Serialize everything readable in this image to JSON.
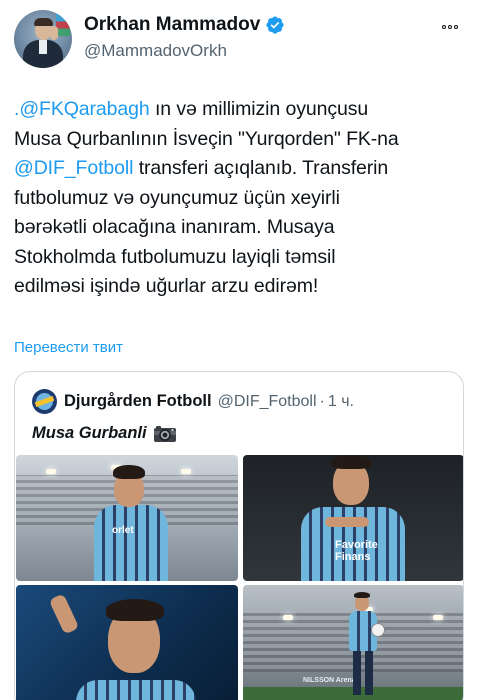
{
  "author": {
    "display_name": "Orkhan Mammadov",
    "handle": "@MammadovOrkh"
  },
  "tweet": {
    "line1_mention": ".@FKQarabagh",
    "line1_rest": " ın və millimizin oyunçusu",
    "line2": "Musa Qurbanlının İsveçin \"Yurqorden\"  FK-na",
    "line3_mention": "@DIF_Fotboll",
    "line3_rest": " transferi açıqlanıb. Transferin",
    "line4": "futbolumuz və oyunçumuz üçün xeyirli",
    "line5": "bərəkətli olacağına inanıram. Musaya",
    "line6": "Stokholmda futbolumuzu layiqli təmsil",
    "line7": "edilməsi işində uğurlar arzu edirəm!"
  },
  "translate_label": "Перевести твит",
  "quote": {
    "display_name": "Djurgården Fotboll",
    "handle": "@DIF_Fotboll",
    "separator": "·",
    "time": "1 ч.",
    "text": "Musa Gurbanli"
  },
  "photos": {
    "p1_sponsor": "orlet",
    "p2_sponsor": "Favorite Finans",
    "p4_sponsor": "NILSSON Arena"
  },
  "colors": {
    "link": "#1d9bf0",
    "secondary_text": "#536471",
    "border": "#cfd9de",
    "verified": "#1d9bf0"
  },
  "icons": [
    "verified-badge-icon",
    "more-options-icon",
    "club-logo-icon",
    "camera-icon"
  ]
}
